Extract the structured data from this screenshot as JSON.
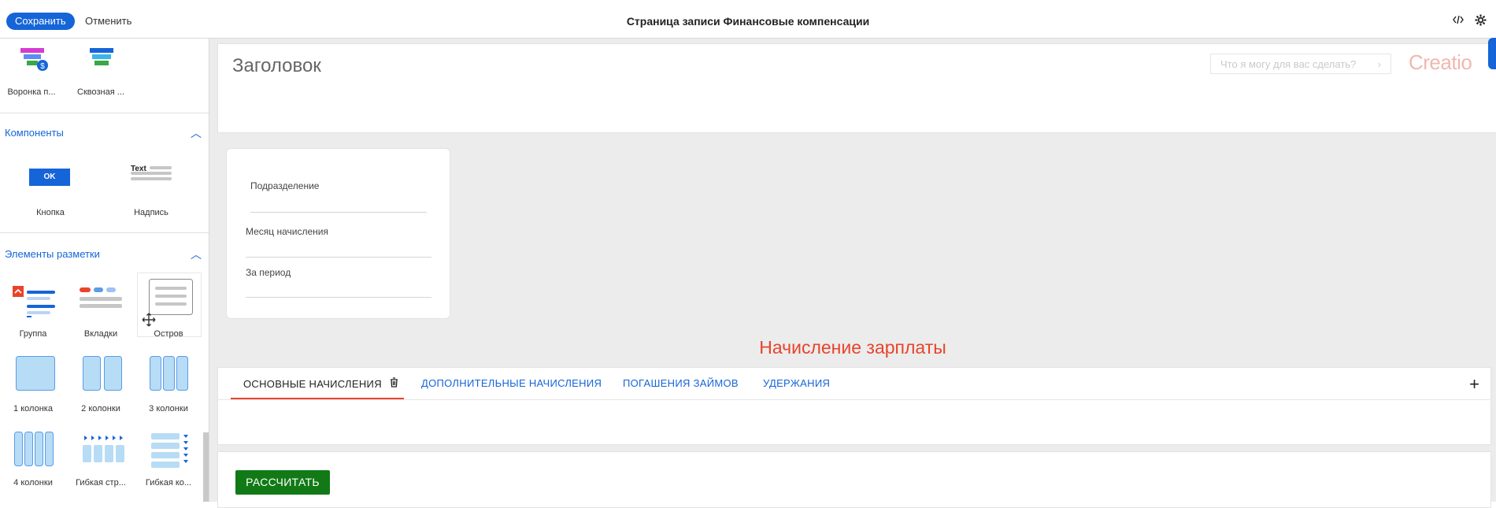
{
  "toolbar": {
    "save_label": "Сохранить",
    "cancel_label": "Отменить",
    "page_title": "Страница записи Финансовые компенсации",
    "code_icon": "code-icon",
    "settings_icon": "gear-icon"
  },
  "sidebar": {
    "funnels": [
      {
        "label": "Воронка п...",
        "icon": "funnel-money-icon"
      },
      {
        "label": "Сквозная ...",
        "icon": "funnel-icon"
      }
    ],
    "components": {
      "title": "Компоненты",
      "items": [
        {
          "label": "Кнопка",
          "icon": "button-icon",
          "badge": "OK"
        },
        {
          "label": "Надпись",
          "icon": "label-icon",
          "badge": "Text"
        }
      ]
    },
    "layout": {
      "title": "Элементы разметки",
      "items": [
        {
          "label": "Группа",
          "icon": "group-icon"
        },
        {
          "label": "Вкладки",
          "icon": "tabs-icon"
        },
        {
          "label": "Остров",
          "icon": "island-icon"
        },
        {
          "label": "1 колонка",
          "icon": "one-column-icon"
        },
        {
          "label": "2 колонки",
          "icon": "two-columns-icon"
        },
        {
          "label": "3 колонки",
          "icon": "three-columns-icon"
        },
        {
          "label": "4 колонки",
          "icon": "four-columns-icon"
        },
        {
          "label": "Гибкая стр...",
          "icon": "flex-row-icon"
        },
        {
          "label": "Гибкая ко...",
          "icon": "flex-column-icon"
        }
      ]
    }
  },
  "header": {
    "title": "Заголовок",
    "search_placeholder": "Что я могу для вас сделать?",
    "brand": "Creatio"
  },
  "fields": {
    "department": "Подразделение",
    "month": "Месяц начисления",
    "period": "За период"
  },
  "salary_section": {
    "title": "Начисление зарплаты",
    "tabs": [
      {
        "label": "ОСНОВНЫЕ НАЧИСЛЕНИЯ",
        "active": true
      },
      {
        "label": "ДОПОЛНИТЕЛЬНЫЕ НАЧИСЛЕНИЯ",
        "active": false
      },
      {
        "label": "ПОГАШЕНИЯ ЗАЙМОВ",
        "active": false
      },
      {
        "label": "УДЕРЖАНИЯ",
        "active": false
      }
    ],
    "add_label": "+"
  },
  "actions": {
    "calculate_label": "РАССЧИТАТЬ"
  },
  "colors": {
    "accent": "#1565d8",
    "active_tab": "#e8442a",
    "calculate": "#117a16"
  }
}
